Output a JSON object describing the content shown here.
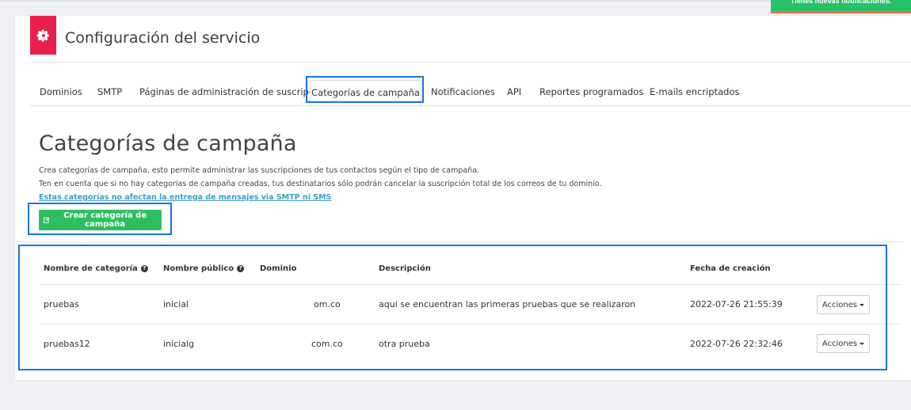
{
  "notification": {
    "text": "Tienes nuevas notificaciones."
  },
  "header": {
    "icon": "gear-icon",
    "title": "Configuración del servicio"
  },
  "tabs": [
    {
      "label": "Dominios"
    },
    {
      "label": "SMTP"
    },
    {
      "label": "Páginas de administración de suscripción"
    },
    {
      "label": "Categorías de campaña",
      "active": true
    },
    {
      "label": "Notificaciones"
    },
    {
      "label": "API"
    },
    {
      "label": "Reportes programados"
    },
    {
      "label": "E-mails encriptados"
    }
  ],
  "main": {
    "title": "Categorías de campaña",
    "desc1": "Crea categorías de campaña, esto permite administrar las suscripciones de tus contactos según el tipo de campaña.",
    "desc2": "Ten en cuenta que si no hay categorias de campaña creadas, tus destinatarios sólo podrán cancelar la suscripción total de los correos de tu dominio.",
    "link": "Estas categorías no afectan la entrega de mensajes via SMTP ni SMS",
    "create_button": "Crear categoría de campaña",
    "create_icon": "edit-icon"
  },
  "table": {
    "headers": {
      "name": "Nombre de categoría",
      "public": "Nombre público",
      "domain": "Dominio",
      "description": "Descripción",
      "created": "Fecha de creación"
    },
    "help_icon": "?",
    "rows": [
      {
        "name": "pruebas",
        "public": "inicial",
        "domain": "om.co",
        "description": "aqui se encuentran las primeras pruebas que se realizaron",
        "created": "2022-07-26 21:55:39",
        "action": "Acciones"
      },
      {
        "name": "pruebas12",
        "public": "inicialg",
        "domain": "com.co",
        "description": "otra prueba",
        "created": "2022-07-26 22:32:46",
        "action": "Acciones"
      }
    ]
  },
  "colors": {
    "brand_red": "#e8204d",
    "green": "#2dbf5f",
    "highlight": "#1a73e8",
    "link": "#3aa0c9"
  }
}
